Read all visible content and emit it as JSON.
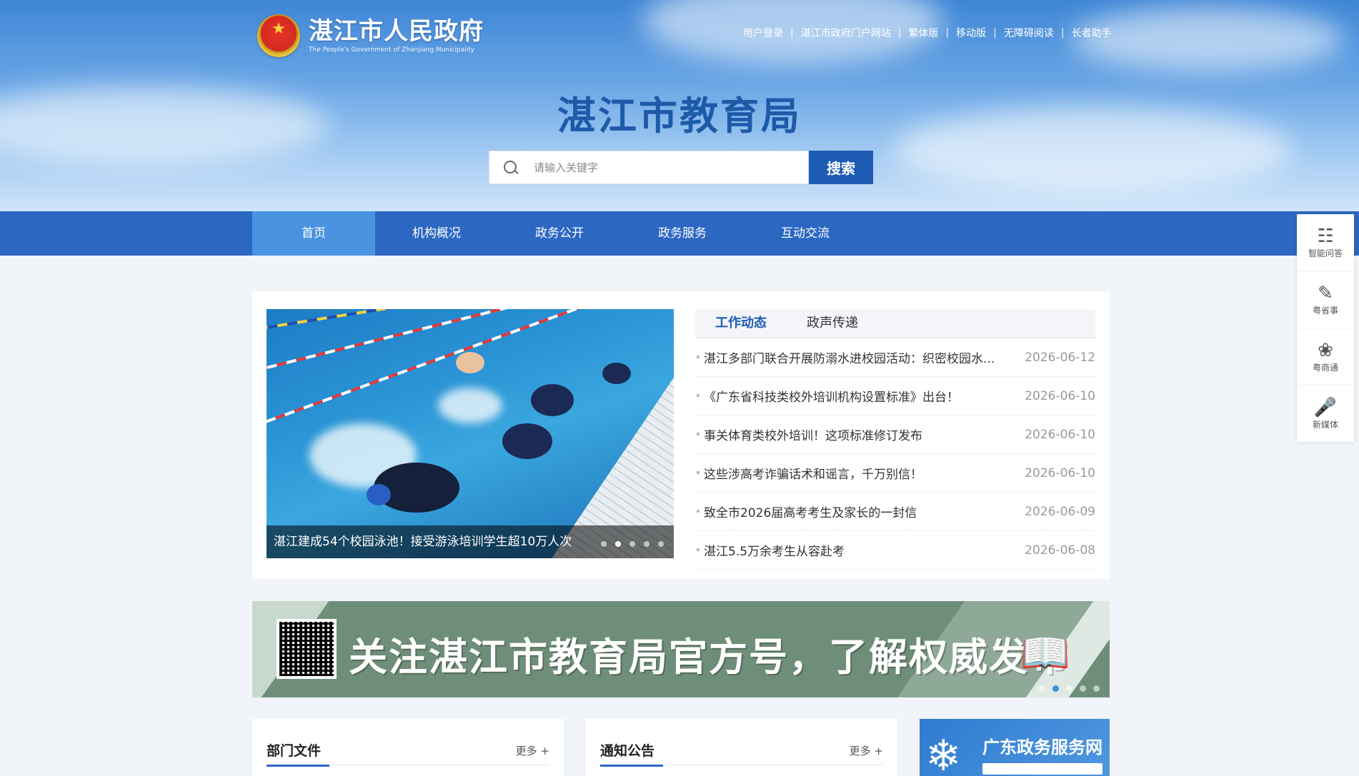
{
  "header": {
    "gov_name": "湛江市人民政府",
    "gov_name_en": "The People's Government of Zhanjiang Municipality",
    "top_links": [
      "用户登录",
      "湛江市政府门户网站",
      "繁体版",
      "移动版",
      "无障碍阅读",
      "长者助手"
    ],
    "site_title": "湛江市教育局"
  },
  "search": {
    "placeholder": "请输入关键字",
    "button_label": "搜索"
  },
  "nav": {
    "items": [
      "首页",
      "机构概况",
      "政务公开",
      "政务服务",
      "互动交流"
    ]
  },
  "sidebar": {
    "items": [
      {
        "label": "智能问答",
        "icon": "robot-icon"
      },
      {
        "label": "粤省事",
        "icon": "yueshengshi-icon"
      },
      {
        "label": "粤商通",
        "icon": "yueshangtong-icon"
      },
      {
        "label": "新媒体",
        "icon": "microphone-icon"
      }
    ]
  },
  "slider": {
    "caption": "湛江建成54个校园泳池！接受游泳培训学生超10万人次",
    "slide_count": 5,
    "active_slide": 2
  },
  "news": {
    "tabs": [
      "工作动态",
      "政声传递"
    ],
    "items": [
      {
        "title": "湛江多部门联合开展防溺水进校园活动：织密校园水...",
        "date": "2026-06-12"
      },
      {
        "title": "《广东省科技类校外培训机构设置标准》出台！",
        "date": "2026-06-10"
      },
      {
        "title": "事关体育类校外培训！这项标准修订发布",
        "date": "2026-06-10"
      },
      {
        "title": "这些涉高考诈骗话术和谣言，千万别信！",
        "date": "2026-06-10"
      },
      {
        "title": "致全市2026届高考考生及家长的一封信",
        "date": "2026-06-09"
      },
      {
        "title": "湛江5.5万余考生从容赴考",
        "date": "2026-06-08"
      }
    ]
  },
  "banner": {
    "text": "关注湛江市教育局官方号，了解权威发布",
    "slide_count": 5,
    "active_slide": 2
  },
  "boxes": [
    {
      "title": "部门文件",
      "more": "更多 +"
    },
    {
      "title": "通知公告",
      "more": "更多 +"
    }
  ],
  "service_banner": {
    "title": "广东政务服务网"
  },
  "colors": {
    "nav_bg": "#2c67c2",
    "nav_active": "#4a93e0",
    "accent": "#1e5bb5",
    "title": "#1d5aa8"
  }
}
